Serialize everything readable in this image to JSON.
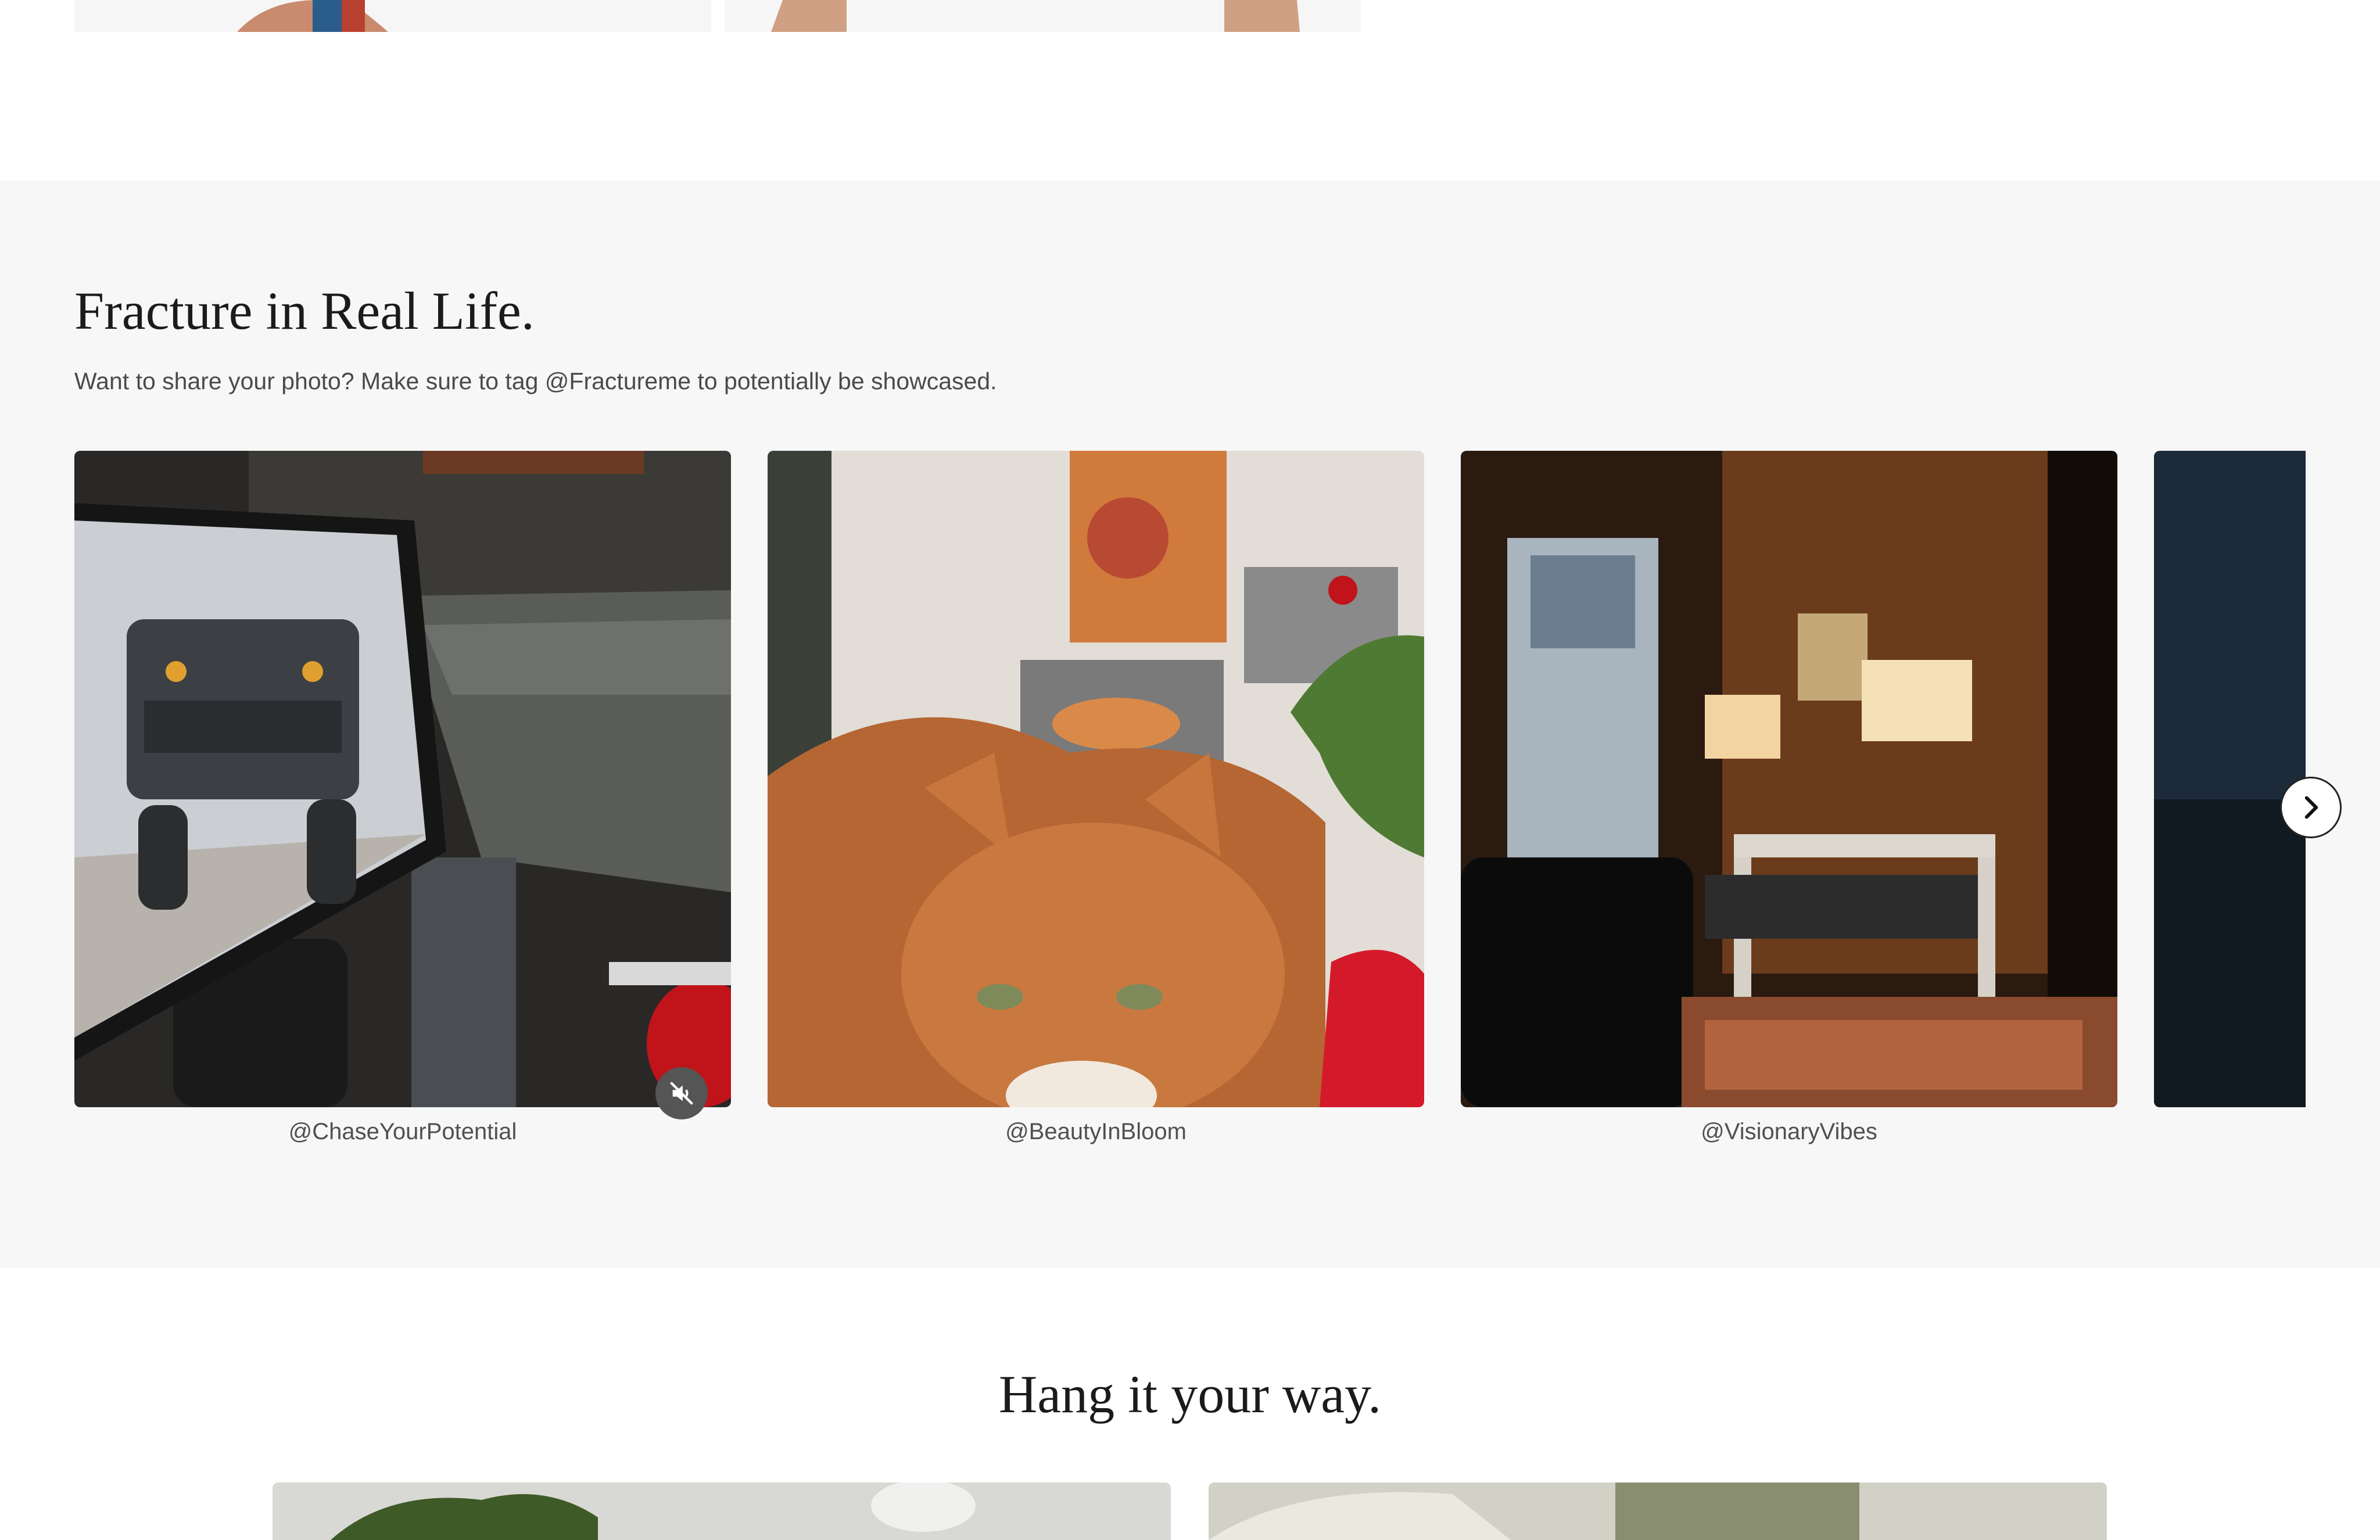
{
  "gallery": {
    "title": "Fracture in Real Life.",
    "subtitle": "Want to share your photo? Make sure to tag @Fractureme to potentially be showcased.",
    "items": [
      {
        "handle": "@ChaseYourPotential"
      },
      {
        "handle": "@BeautyInBloom"
      },
      {
        "handle": "@VisionaryVibes"
      }
    ]
  },
  "hang": {
    "title": "Hang it your way."
  }
}
